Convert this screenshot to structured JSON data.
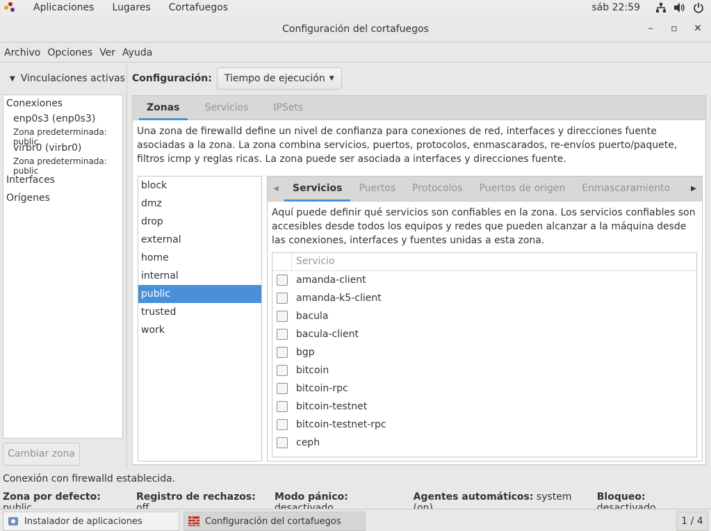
{
  "topbar": {
    "apps": "Aplicaciones",
    "places": "Lugares",
    "current_app": "Cortafuegos",
    "clock": "sáb 22:59",
    "icons": [
      "network-icon",
      "volume-icon",
      "power-icon"
    ]
  },
  "window": {
    "title": "Configuración del cortafuegos",
    "minimize": "–",
    "maximize": "▫",
    "close": "✕"
  },
  "menubar": [
    "Archivo",
    "Opciones",
    "Ver",
    "Ayuda"
  ],
  "left": {
    "header": "Vinculaciones activas",
    "connections_label": "Conexiones",
    "connections": [
      {
        "name": "enp0s3 (enp0s3)",
        "zone": "Zona predeterminada: public"
      },
      {
        "name": "virbr0 (virbr0)",
        "zone": "Zona predeterminada: public"
      }
    ],
    "interfaces_label": "Interfaces",
    "sources_label": "Orígenes",
    "change_zone": "Cambiar zona"
  },
  "config": {
    "label": "Configuración:",
    "value": "Tiempo de ejecución"
  },
  "main_tabs": [
    "Zonas",
    "Servicios",
    "IPSets"
  ],
  "zone_description": "Una zona de firewalld define un nivel de confianza para conexiones de red, interfaces y direcciones fuente asociadas a la zona. La zona combina servicios, puertos, protocolos, enmascarados, re-envíos puerto/paquete, filtros icmp y reglas ricas. La zona puede ser asociada a interfaces y direcciones fuente.",
  "zones": [
    "block",
    "dmz",
    "drop",
    "external",
    "home",
    "internal",
    "public",
    "trusted",
    "work"
  ],
  "selected_zone": "public",
  "service_tabs": [
    "Servicios",
    "Puertos",
    "Protocolos",
    "Puertos de origen",
    "Enmascaramiento"
  ],
  "service_description": "Aquí puede definir qué servicios son confiables en la zona. Los servicios confiables son accesibles desde todos los equipos y redes que pueden alcanzar a la máquina desde las conexiones, interfaces y fuentes unidas a esta zona.",
  "service_table": {
    "header": "Servicio",
    "rows": [
      "amanda-client",
      "amanda-k5-client",
      "bacula",
      "bacula-client",
      "bgp",
      "bitcoin",
      "bitcoin-rpc",
      "bitcoin-testnet",
      "bitcoin-testnet-rpc",
      "ceph"
    ]
  },
  "status": {
    "line1": "Conexión con firewalld establecida.",
    "default_zone_label": "Zona por defecto:",
    "default_zone_value": "public",
    "log_denied_label": "Registro de rechazos:",
    "log_denied_value": "off",
    "panic_label": "Modo pánico:",
    "panic_value": "desactivado",
    "helpers_label": "Agentes automáticos:",
    "helpers_value": "system (on)",
    "lockdown_label": "Bloqueo:",
    "lockdown_value": "desactivado"
  },
  "taskbar": {
    "task1": "Instalador de aplicaciones",
    "task2": "Configuración del cortafuegos",
    "pager": "1 / 4"
  }
}
